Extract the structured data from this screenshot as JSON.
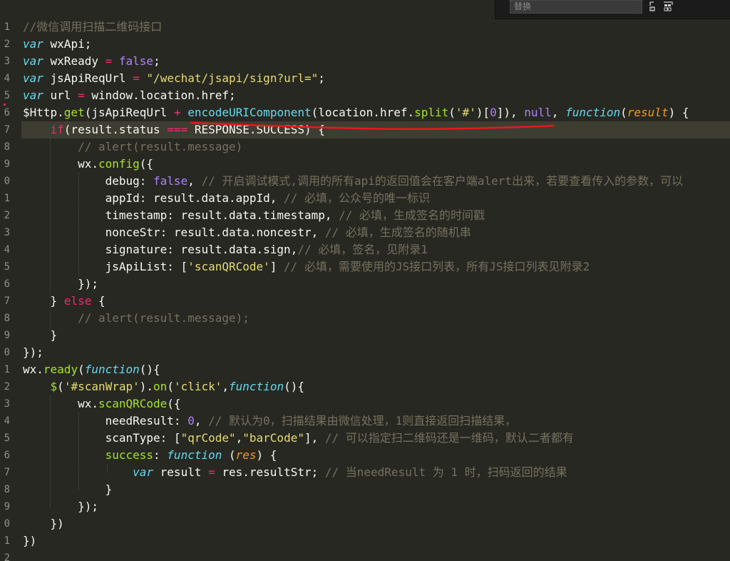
{
  "find_panel": {
    "replace_placeholder": "替换",
    "btn_1": "[C]",
    "btn_2": "[R]"
  },
  "gutter": {
    "line_numbers": [
      "1",
      "2",
      "3",
      "4",
      "5",
      "6",
      "7",
      "8",
      "9",
      "0",
      "1",
      "2",
      "3",
      "4",
      "5",
      "6",
      "7",
      "8",
      "9",
      "0",
      "1",
      "2",
      "3",
      "4",
      "5",
      "6",
      "7",
      "8",
      "9",
      "0",
      "1",
      "2"
    ]
  },
  "colors": {
    "background": "#272822",
    "keyword": "#66d9ef",
    "control": "#f92672",
    "string": "#e6db74",
    "number": "#ae81ff",
    "property": "#a6e22e",
    "param": "#fd971f",
    "comment": "#75715e",
    "annotation": "#e8181c"
  },
  "code_lines": [
    [
      [
        "cmt",
        "//微信调用扫描二维码接口"
      ]
    ],
    [
      [
        "kw",
        "var"
      ],
      [
        "plain",
        " wxApi;"
      ]
    ],
    [
      [
        "kw",
        "var"
      ],
      [
        "plain",
        " wxReady "
      ],
      [
        "op",
        "="
      ],
      [
        "plain",
        " "
      ],
      [
        "num",
        "false"
      ],
      [
        "plain",
        ";"
      ]
    ],
    [
      [
        "kw",
        "var"
      ],
      [
        "plain",
        " jsApiReqUrl "
      ],
      [
        "op",
        "="
      ],
      [
        "plain",
        " "
      ],
      [
        "str",
        "\"/wechat/jsapi/sign?url=\""
      ],
      [
        "plain",
        ";"
      ]
    ],
    [
      [
        "kw",
        "var"
      ],
      [
        "plain",
        " url "
      ],
      [
        "op",
        "="
      ],
      [
        "plain",
        " window.location.href;"
      ]
    ],
    [
      [
        "plain",
        "$Http."
      ],
      [
        "prop",
        "get"
      ],
      [
        "plain",
        "(jsApiReqUrl "
      ],
      [
        "op",
        "+"
      ],
      [
        "plain",
        " "
      ],
      [
        "fn",
        "encodeURIComponent"
      ],
      [
        "plain",
        "(location.href."
      ],
      [
        "prop",
        "split"
      ],
      [
        "plain",
        "("
      ],
      [
        "str",
        "'#'"
      ],
      [
        "plain",
        ")["
      ],
      [
        "num",
        "0"
      ],
      [
        "plain",
        "]), "
      ],
      [
        "num",
        "null"
      ],
      [
        "plain",
        ", "
      ],
      [
        "kw",
        "function"
      ],
      [
        "plain",
        "("
      ],
      [
        "param",
        "result"
      ],
      [
        "plain",
        ") {"
      ]
    ],
    [
      [
        "plain",
        "    "
      ],
      [
        "ctl",
        "if"
      ],
      [
        "plain",
        "(result.status "
      ],
      [
        "op",
        "==="
      ],
      [
        "plain",
        " RESPONSE.SUCCESS) {"
      ]
    ],
    [
      [
        "plain",
        "        "
      ],
      [
        "cmt",
        "// alert(result.message)"
      ]
    ],
    [
      [
        "plain",
        "        wx."
      ],
      [
        "prop",
        "config"
      ],
      [
        "plain",
        "({"
      ]
    ],
    [
      [
        "plain",
        "            debug: "
      ],
      [
        "num",
        "false"
      ],
      [
        "plain",
        ", "
      ],
      [
        "cmt",
        "// 开启调试模式,调用的所有api的返回值会在客户端alert出来，若要查看传入的参数，可以"
      ]
    ],
    [
      [
        "plain",
        "            appId: result.data.appId, "
      ],
      [
        "cmt",
        "// 必填，公众号的唯一标识"
      ]
    ],
    [
      [
        "plain",
        "            timestamp: result.data.timestamp, "
      ],
      [
        "cmt",
        "// 必填，生成签名的时间戳"
      ]
    ],
    [
      [
        "plain",
        "            nonceStr: result.data.noncestr, "
      ],
      [
        "cmt",
        "// 必填，生成签名的随机串"
      ]
    ],
    [
      [
        "plain",
        "            signature: result.data.sign,"
      ],
      [
        "cmt",
        "// 必填，签名，见附录1"
      ]
    ],
    [
      [
        "plain",
        "            jsApiList: ["
      ],
      [
        "str",
        "'scanQRCode'"
      ],
      [
        "plain",
        "] "
      ],
      [
        "cmt",
        "// 必填，需要使用的JS接口列表，所有JS接口列表见附录2"
      ]
    ],
    [
      [
        "plain",
        "        });"
      ]
    ],
    [
      [
        "plain",
        "    } "
      ],
      [
        "ctl",
        "else"
      ],
      [
        "plain",
        " {"
      ]
    ],
    [
      [
        "plain",
        "        "
      ],
      [
        "cmt",
        "// alert(result.message);"
      ]
    ],
    [
      [
        "plain",
        "    }"
      ]
    ],
    [
      [
        "plain",
        "});"
      ]
    ],
    [
      [
        "plain",
        "wx."
      ],
      [
        "prop",
        "ready"
      ],
      [
        "plain",
        "("
      ],
      [
        "kw",
        "function"
      ],
      [
        "plain",
        "(){"
      ]
    ],
    [
      [
        "plain",
        "    "
      ],
      [
        "prop",
        "$"
      ],
      [
        "plain",
        "("
      ],
      [
        "str",
        "'#scanWrap'"
      ],
      [
        "plain",
        ")."
      ],
      [
        "prop",
        "on"
      ],
      [
        "plain",
        "("
      ],
      [
        "str",
        "'click'"
      ],
      [
        "plain",
        ","
      ],
      [
        "kw",
        "function"
      ],
      [
        "plain",
        "(){"
      ]
    ],
    [
      [
        "plain",
        "        wx."
      ],
      [
        "prop",
        "scanQRCode"
      ],
      [
        "plain",
        "({"
      ]
    ],
    [
      [
        "plain",
        "            needResult: "
      ],
      [
        "num",
        "0"
      ],
      [
        "plain",
        ", "
      ],
      [
        "cmt",
        "// 默认为0，扫描结果由微信处理，1则直接返回扫描结果，"
      ]
    ],
    [
      [
        "plain",
        "            scanType: ["
      ],
      [
        "str",
        "\"qrCode\""
      ],
      [
        "plain",
        ","
      ],
      [
        "str",
        "\"barCode\""
      ],
      [
        "plain",
        "], "
      ],
      [
        "cmt",
        "// 可以指定扫二维码还是一维码，默认二者都有"
      ]
    ],
    [
      [
        "plain",
        "            "
      ],
      [
        "prop",
        "success"
      ],
      [
        "plain",
        ": "
      ],
      [
        "kw",
        "function"
      ],
      [
        "plain",
        " ("
      ],
      [
        "param",
        "res"
      ],
      [
        "plain",
        ") {"
      ]
    ],
    [
      [
        "plain",
        "                "
      ],
      [
        "kw",
        "var"
      ],
      [
        "plain",
        " result "
      ],
      [
        "op",
        "="
      ],
      [
        "plain",
        " res.resultStr; "
      ],
      [
        "cmt",
        "// 当needResult 为 1 时，扫码返回的结果"
      ]
    ],
    [
      [
        "plain",
        "            }"
      ]
    ],
    [
      [
        "plain",
        "        });"
      ]
    ],
    [
      [
        "plain",
        "    })"
      ]
    ],
    [
      [
        "plain",
        "})"
      ]
    ],
    [
      [
        "plain",
        ""
      ]
    ]
  ]
}
